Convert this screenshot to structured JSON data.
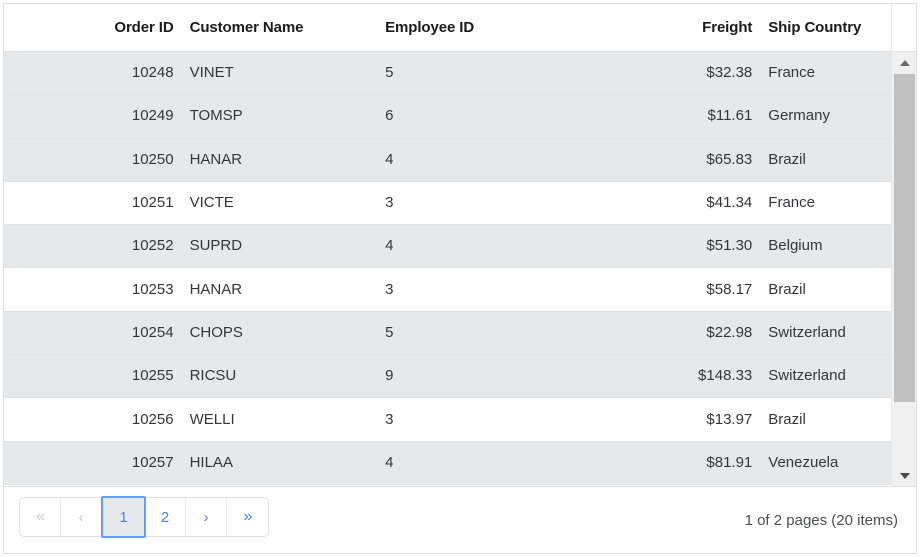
{
  "grid": {
    "columns": [
      {
        "key": "order_id",
        "label": "Order ID",
        "align": "right"
      },
      {
        "key": "customer_name",
        "label": "Customer Name",
        "align": "left"
      },
      {
        "key": "employee_id",
        "label": "Employee ID",
        "align": "left"
      },
      {
        "key": "freight",
        "label": "Freight",
        "align": "right"
      },
      {
        "key": "ship_country",
        "label": "Ship Country",
        "align": "left"
      }
    ],
    "rows": [
      {
        "order_id": "10248",
        "customer_name": "VINET",
        "employee_id": "5",
        "freight": "$32.38",
        "ship_country": "France"
      },
      {
        "order_id": "10249",
        "customer_name": "TOMSP",
        "employee_id": "6",
        "freight": "$11.61",
        "ship_country": "Germany"
      },
      {
        "order_id": "10250",
        "customer_name": "HANAR",
        "employee_id": "4",
        "freight": "$65.83",
        "ship_country": "Brazil"
      },
      {
        "order_id": "10251",
        "customer_name": "VICTE",
        "employee_id": "3",
        "freight": "$41.34",
        "ship_country": "France"
      },
      {
        "order_id": "10252",
        "customer_name": "SUPRD",
        "employee_id": "4",
        "freight": "$51.30",
        "ship_country": "Belgium"
      },
      {
        "order_id": "10253",
        "customer_name": "HANAR",
        "employee_id": "3",
        "freight": "$58.17",
        "ship_country": "Brazil"
      },
      {
        "order_id": "10254",
        "customer_name": "CHOPS",
        "employee_id": "5",
        "freight": "$22.98",
        "ship_country": "Switzerland"
      },
      {
        "order_id": "10255",
        "customer_name": "RICSU",
        "employee_id": "9",
        "freight": "$148.33",
        "ship_country": "Switzerland"
      },
      {
        "order_id": "10256",
        "customer_name": "WELLI",
        "employee_id": "3",
        "freight": "$13.97",
        "ship_country": "Brazil"
      },
      {
        "order_id": "10257",
        "customer_name": "HILAA",
        "employee_id": "4",
        "freight": "$81.91",
        "ship_country": "Venezuela"
      }
    ],
    "row_shading": [
      "alt",
      "alt",
      "alt",
      "plain",
      "alt",
      "plain",
      "alt",
      "alt",
      "plain",
      "alt"
    ]
  },
  "scrollbar": {
    "up_arrow": "triangle-up-icon",
    "down_arrow": "triangle-down-icon"
  },
  "pagination": {
    "buttons": [
      {
        "name": "first-page",
        "label": "«",
        "state": "disabled",
        "double": true
      },
      {
        "name": "previous-page",
        "label": "‹",
        "state": "disabled",
        "double": false
      },
      {
        "name": "page-1",
        "label": "1",
        "state": "current",
        "double": false
      },
      {
        "name": "page-2",
        "label": "2",
        "state": "enabled",
        "double": false
      },
      {
        "name": "next-page",
        "label": "›",
        "state": "enabled",
        "double": false
      },
      {
        "name": "last-page",
        "label": "»",
        "state": "enabled",
        "double": true
      }
    ],
    "info": "1 of 2 pages (20 items)"
  },
  "colors": {
    "accent": "#4285f4",
    "selected_border": "#64a0f5",
    "row_alt": "#e5e9eb",
    "row_plain": "#ffffff",
    "border": "#dfe2e5",
    "header_text": "#1b1b1f",
    "cell_text": "#33373b",
    "disabled": "#c6cbd1",
    "scroll_thumb": "#bfbfbf",
    "scroll_track": "#f0f0f0"
  }
}
